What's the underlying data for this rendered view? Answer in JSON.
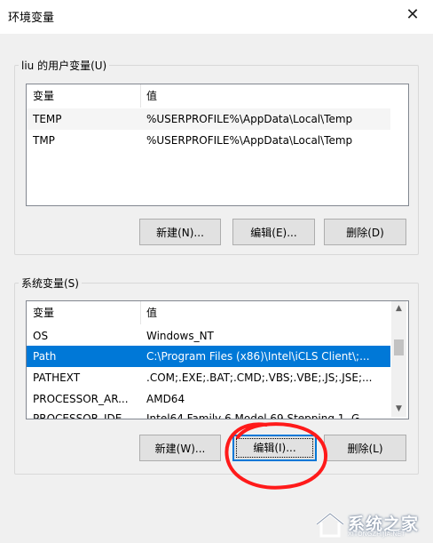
{
  "window": {
    "title": "环境变量",
    "close_glyph": "✕"
  },
  "user_vars": {
    "group_label": "liu 的用户变量(U)",
    "headers": [
      "变量",
      "值"
    ],
    "rows": [
      {
        "name": "TEMP",
        "value": "%USERPROFILE%\\AppData\\Local\\Temp"
      },
      {
        "name": "TMP",
        "value": "%USERPROFILE%\\AppData\\Local\\Temp"
      }
    ],
    "buttons": {
      "new": "新建(N)...",
      "edit": "编辑(E)...",
      "delete": "删除(D)"
    }
  },
  "system_vars": {
    "group_label": "系统变量(S)",
    "headers": [
      "变量",
      "值"
    ],
    "rows": [
      {
        "name": "OS",
        "value": "Windows_NT"
      },
      {
        "name": "Path",
        "value": "C:\\Program Files (x86)\\Intel\\iCLS Client\\;..."
      },
      {
        "name": "PATHEXT",
        "value": ".COM;.EXE;.BAT;.CMD;.VBS;.VBE;.JS;.JSE;..."
      },
      {
        "name": "PROCESSOR_AR...",
        "value": "AMD64"
      },
      {
        "name": "PROCESSOR_IDE...",
        "value": "Intel64 Family 6 Model 69 Stepping 1, G..."
      }
    ],
    "selected_row": "Path",
    "buttons": {
      "new": "新建(W)...",
      "edit": "编辑(I)...",
      "delete": "删除(L)"
    }
  },
  "watermark": {
    "text": "系统之家",
    "subtext": "XITONGZHIJIA.NET"
  },
  "colors": {
    "selection": "#0078d7",
    "annotation_red": "#ff1a1a"
  }
}
